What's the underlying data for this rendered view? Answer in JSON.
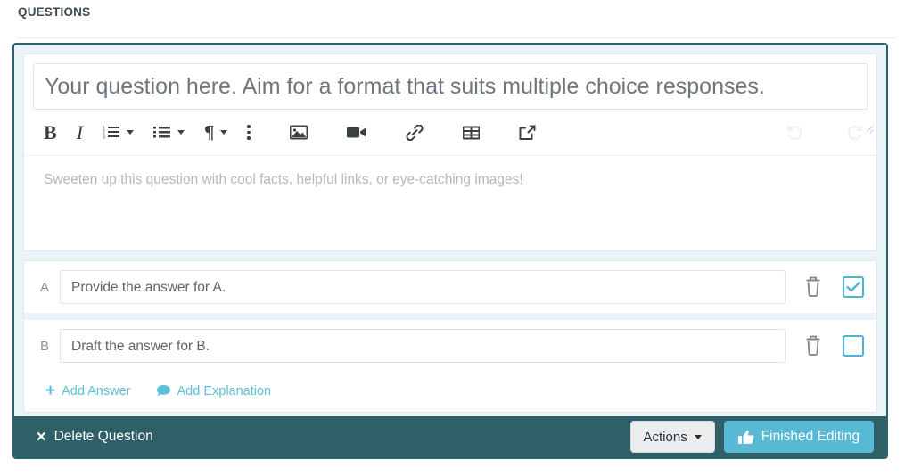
{
  "section": {
    "title": "QUESTIONS"
  },
  "question": {
    "title_placeholder": "Your question here. Aim for a format that suits multiple choice responses.",
    "title_value": "",
    "body_placeholder": "Sweeten up this question with cool facts, helpful links, or eye-catching images!"
  },
  "toolbar": {
    "bold": "B",
    "italic": "I",
    "ordered_list": "ordered-list-icon",
    "unordered_list": "unordered-list-icon",
    "paragraph": "¶",
    "more": "more-options-icon",
    "image": "image-icon",
    "video": "video-icon",
    "link": "link-icon",
    "table": "table-icon",
    "embed": "external-link-icon",
    "undo": "undo-icon",
    "redo": "redo-icon"
  },
  "answers": [
    {
      "letter": "A",
      "placeholder": "Provide the answer for A.",
      "value": "",
      "correct": true,
      "delete_label": "trash-icon"
    },
    {
      "letter": "B",
      "placeholder": "Draft the answer for B.",
      "value": "",
      "correct": false,
      "delete_label": "trash-icon"
    }
  ],
  "actions": {
    "add_answer": "Add Answer",
    "add_answer_icon": "+",
    "add_explanation": "Add Explanation",
    "add_explanation_icon": "comment-icon"
  },
  "footer": {
    "delete_question": "Delete Question",
    "delete_icon": "✕",
    "actions_button": "Actions",
    "finished_button": "Finished Editing",
    "finished_icon": "thumbs-up-icon"
  },
  "colors": {
    "panel_border": "#2c6269",
    "panel_bg": "#e9f4f6",
    "accent_cyan": "#58b9d4",
    "link_cyan": "#5cc0d8",
    "footer_bg": "#2f6068"
  }
}
